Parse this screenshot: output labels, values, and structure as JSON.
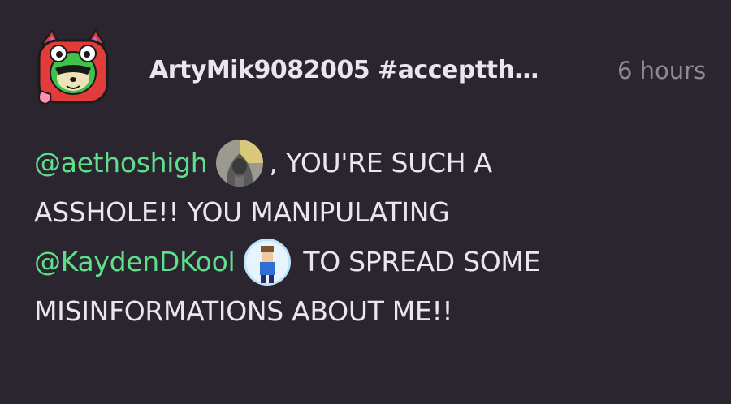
{
  "post": {
    "author": "ArtyMik9082005 #acceptth…",
    "timestamp": "6 hours",
    "body": {
      "mention1": "@aethoshigh",
      "text1": ", YOU'RE SUCH A",
      "text2": "ASSHOLE!! YOU MANIPULATING",
      "mention2": "@KaydenDKool",
      "text3": "TO SPREAD SOME",
      "text4": "MISINFORMATIONS ABOUT ME!!"
    }
  },
  "icons": {
    "author_avatar": "cartoon-animal-avatar-icon",
    "mention1_avatar": "hooded-figure-avatar-icon",
    "mention2_avatar": "boy-character-avatar-icon"
  },
  "colors": {
    "background": "#2b2530",
    "text": "#e9e6ee",
    "mention": "#5ee08b",
    "timestamp": "#8e8a93"
  }
}
